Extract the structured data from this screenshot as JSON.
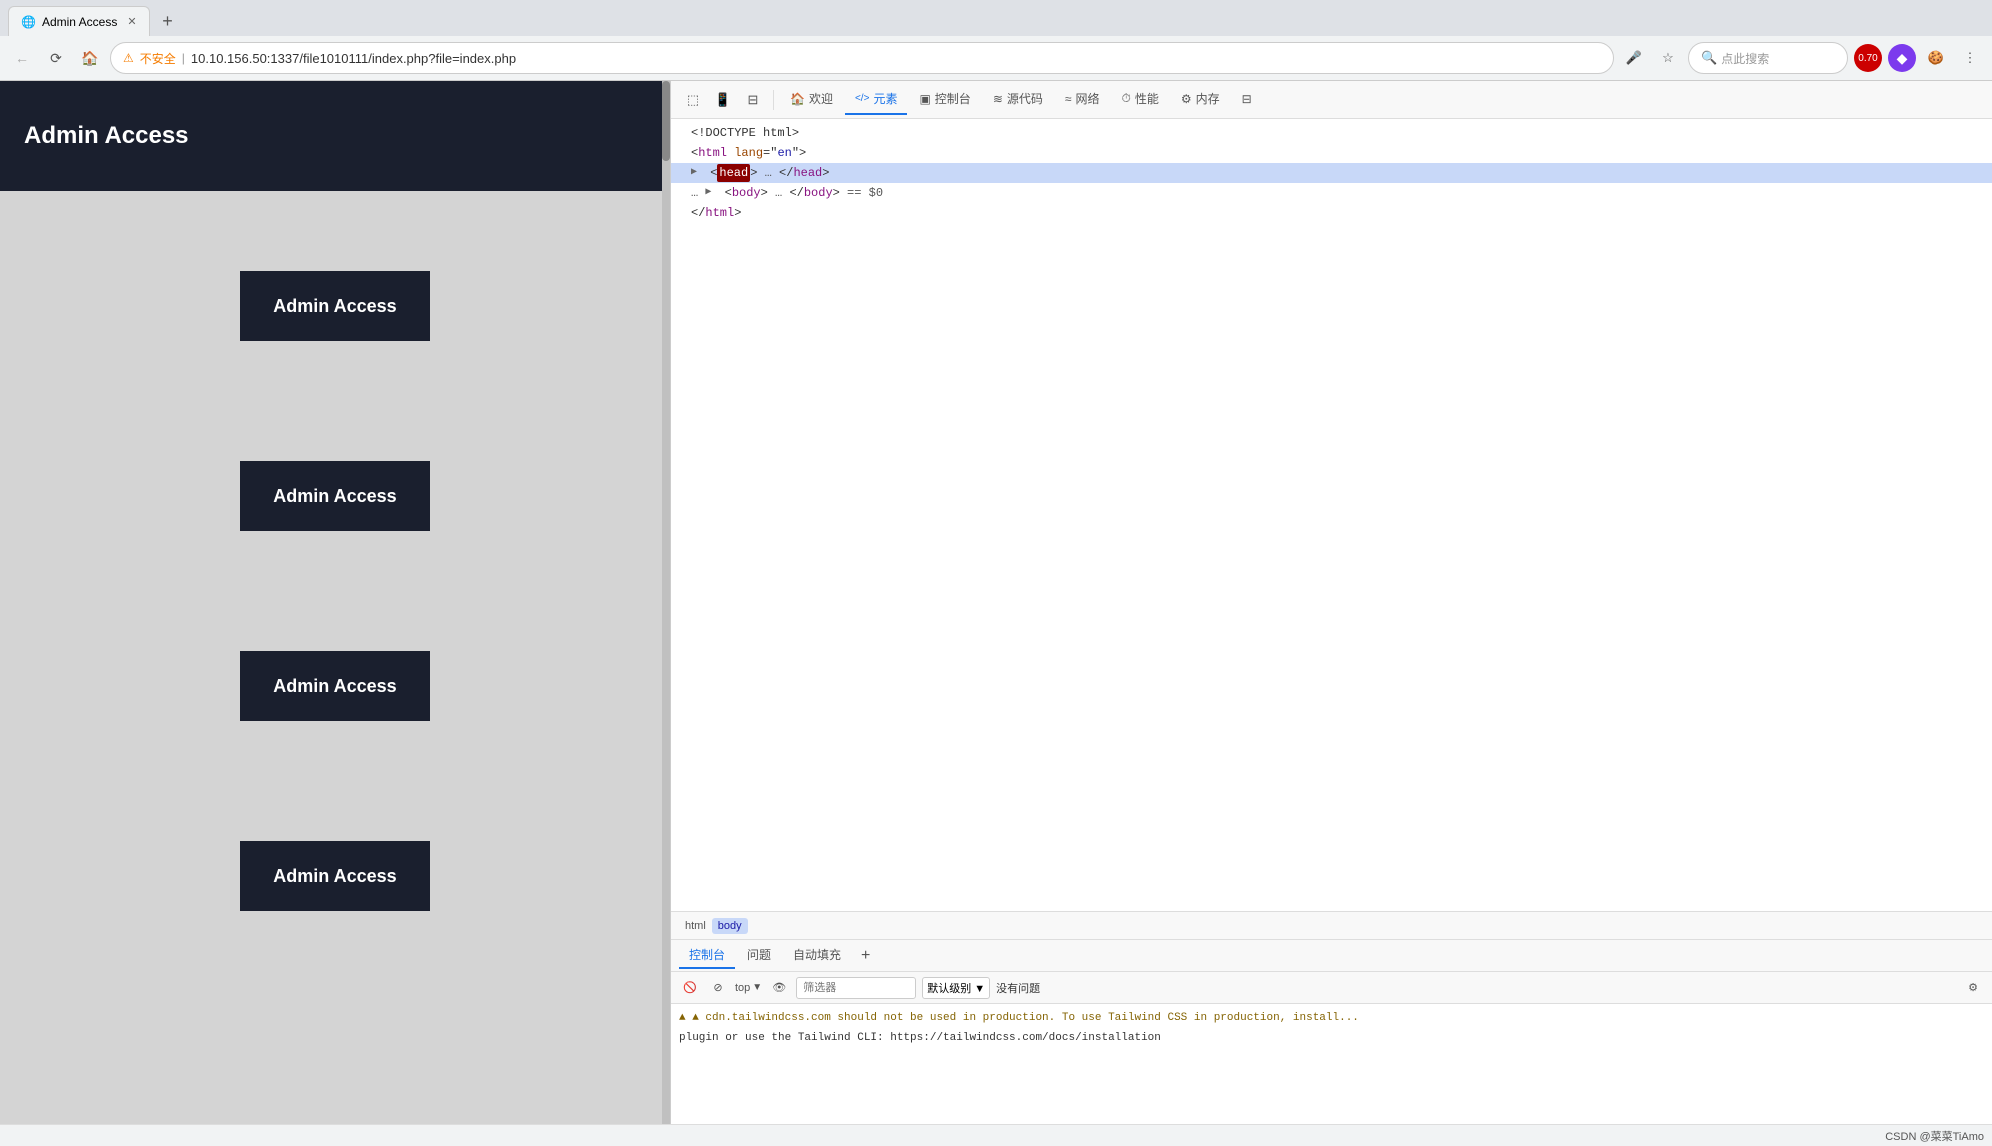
{
  "browser": {
    "url": "10.10.156.50:1337/file1010111/index.php?file=index.php",
    "warning_text": "不安全",
    "back_disabled": true,
    "loading": true,
    "tab_title": "Admin Access",
    "search_placeholder": "点此搜索",
    "badge_count": "0.70"
  },
  "webpage": {
    "header_title": "Admin Access",
    "buttons": [
      {
        "label": "Admin Access"
      },
      {
        "label": "Admin Access"
      },
      {
        "label": "Admin Access"
      },
      {
        "label": "Admin Access"
      }
    ]
  },
  "devtools": {
    "toolbar_tabs": [
      {
        "label": "欢迎",
        "icon": "🏠",
        "active": false
      },
      {
        "label": "元素",
        "icon": "</>",
        "active": true
      },
      {
        "label": "控制台",
        "icon": "▣",
        "active": false
      },
      {
        "label": "源代码",
        "icon": "≋",
        "active": false
      },
      {
        "label": "网络",
        "icon": "≈",
        "active": false
      },
      {
        "label": "性能",
        "icon": "⏱",
        "active": false
      },
      {
        "label": "内存",
        "icon": "⚙",
        "active": false
      }
    ],
    "html_content": [
      {
        "indent": 0,
        "text": "<!DOCTYPE html>",
        "type": "normal"
      },
      {
        "indent": 0,
        "text": "<html lang=\"en\">",
        "type": "normal"
      },
      {
        "indent": 1,
        "arrow": "▶",
        "text": "head",
        "type": "highlighted",
        "suffix": "… </head>"
      },
      {
        "indent": 1,
        "text": "…",
        "arrow": "▶",
        "tagname": "body",
        "type": "body-line",
        "suffix": " … </body> == $0"
      },
      {
        "indent": 0,
        "text": "</html>",
        "type": "normal"
      }
    ],
    "breadcrumb": [
      "html",
      "body"
    ],
    "bottom_tabs": [
      "控制台",
      "问题",
      "自动填充"
    ],
    "console": {
      "filter_placeholder": "筛选器",
      "level": "默认级别",
      "status": "没有问题",
      "lines": [
        {
          "type": "warning",
          "text": "▲ cdn.tailwindcss.com should not be used in production. To use Tailwind CSS in production, install..."
        },
        {
          "type": "warning",
          "text": "plugin or use the Tailwind CLI: https://tailwindcss.com/docs/installation"
        }
      ]
    }
  },
  "status_bar": {
    "right_text": "CSDN @菜菜TiAmo"
  }
}
